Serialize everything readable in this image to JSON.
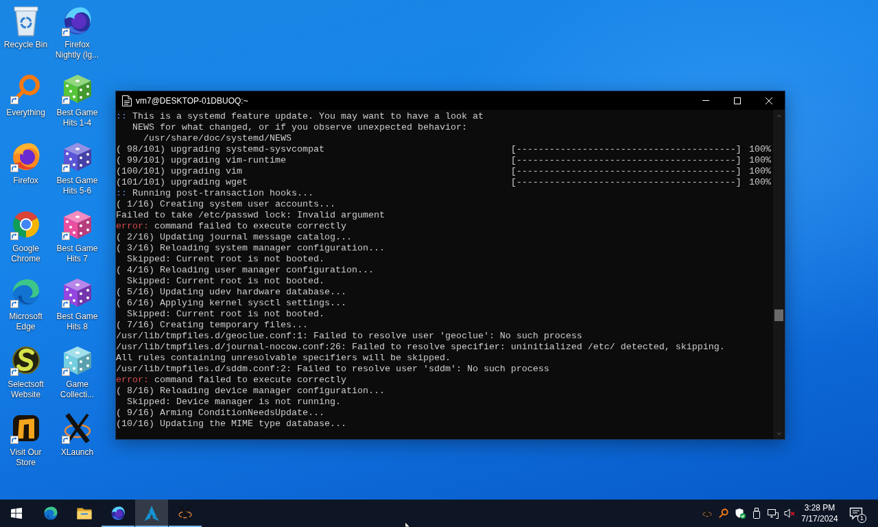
{
  "desktop": {
    "icons": [
      {
        "label": "Recycle Bin",
        "kind": "recycle",
        "shortcut": false
      },
      {
        "label": "Everything",
        "kind": "magnifier",
        "shortcut": true
      },
      {
        "label": "Firefox",
        "kind": "firefox",
        "shortcut": true
      },
      {
        "label": "Google Chrome",
        "kind": "chrome",
        "shortcut": true
      },
      {
        "label": "Microsoft Edge",
        "kind": "edge",
        "shortcut": true
      },
      {
        "label": "Selectsoft Website",
        "kind": "selectsoft",
        "shortcut": true
      },
      {
        "label": "Visit Our Store",
        "kind": "store",
        "shortcut": true
      },
      {
        "label": "Firefox Nightly (lg...",
        "kind": "nightly",
        "shortcut": true
      },
      {
        "label": "Best Game Hits 1-4",
        "kind": "dice",
        "color": "#58c43a",
        "shortcut": true
      },
      {
        "label": "Best Game Hits 5-6",
        "kind": "dice",
        "color": "#5b55d6",
        "shortcut": true
      },
      {
        "label": "Best Game Hits 7",
        "kind": "dice",
        "color": "#ec4fa0",
        "shortcut": true
      },
      {
        "label": "Best Game Hits 8",
        "kind": "dice",
        "color": "#9446de",
        "shortcut": true
      },
      {
        "label": "Game Collecti...",
        "kind": "dice",
        "color": "#74cfe0",
        "shortcut": true
      },
      {
        "label": "XLaunch",
        "kind": "xlaunch",
        "shortcut": true
      }
    ]
  },
  "terminal": {
    "title": "vm7@DESKTOP-01DBUOQ:~",
    "lines": [
      {
        "kind": "notice",
        "prefix": "::",
        "text": "This is a systemd feature update. You may want to have a look at"
      },
      {
        "kind": "plain",
        "text": "   NEWS for what changed, or if you observe unexpected behavior:"
      },
      {
        "kind": "plain",
        "text": "     /usr/share/doc/systemd/NEWS"
      },
      {
        "kind": "progress",
        "text": "( 98/101) upgrading systemd-sysvcompat",
        "bar": "[----------------------------------------]",
        "reading": "100%"
      },
      {
        "kind": "progress",
        "text": "( 99/101) upgrading vim-runtime",
        "bar": "[----------------------------------------]",
        "reading": "100%"
      },
      {
        "kind": "progress",
        "text": "(100/101) upgrading vim",
        "bar": "[----------------------------------------]",
        "reading": "100%"
      },
      {
        "kind": "progress",
        "text": "(101/101) upgrading wget",
        "bar": "[----------------------------------------]",
        "reading": "100%"
      },
      {
        "kind": "notice",
        "prefix": "::",
        "text": "Running post-transaction hooks..."
      },
      {
        "kind": "plain",
        "text": "( 1/16) Creating system user accounts..."
      },
      {
        "kind": "plain",
        "text": "Failed to take /etc/passwd lock: Invalid argument"
      },
      {
        "kind": "error",
        "prefix": "error:",
        "text": "command failed to execute correctly"
      },
      {
        "kind": "plain",
        "text": "( 2/16) Updating journal message catalog..."
      },
      {
        "kind": "plain",
        "text": "( 3/16) Reloading system manager configuration..."
      },
      {
        "kind": "plain",
        "text": "  Skipped: Current root is not booted."
      },
      {
        "kind": "plain",
        "text": "( 4/16) Reloading user manager configuration..."
      },
      {
        "kind": "plain",
        "text": "  Skipped: Current root is not booted."
      },
      {
        "kind": "plain",
        "text": "( 5/16) Updating udev hardware database..."
      },
      {
        "kind": "plain",
        "text": "( 6/16) Applying kernel sysctl settings..."
      },
      {
        "kind": "plain",
        "text": "  Skipped: Current root is not booted."
      },
      {
        "kind": "plain",
        "text": "( 7/16) Creating temporary files..."
      },
      {
        "kind": "plain",
        "text": "/usr/lib/tmpfiles.d/geoclue.conf:1: Failed to resolve user 'geoclue': No such process"
      },
      {
        "kind": "plain",
        "text": "/usr/lib/tmpfiles.d/journal-nocow.conf:26: Failed to resolve specifier: uninitialized /etc/ detected, skipping."
      },
      {
        "kind": "plain",
        "text": "All rules containing unresolvable specifiers will be skipped."
      },
      {
        "kind": "plain",
        "text": "/usr/lib/tmpfiles.d/sddm.conf:2: Failed to resolve user 'sddm': No such process"
      },
      {
        "kind": "error",
        "prefix": "error:",
        "text": "command failed to execute correctly"
      },
      {
        "kind": "plain",
        "text": "( 8/16) Reloading device manager configuration..."
      },
      {
        "kind": "plain",
        "text": "  Skipped: Device manager is not running."
      },
      {
        "kind": "plain",
        "text": "( 9/16) Arming ConditionNeedsUpdate..."
      },
      {
        "kind": "plain",
        "text": "(10/16) Updating the MIME type database..."
      }
    ]
  },
  "taskbar": {
    "apps": [
      {
        "kind": "edge",
        "running": false,
        "selected": false
      },
      {
        "kind": "explorer",
        "running": false,
        "selected": false
      },
      {
        "kind": "nightly",
        "running": true,
        "selected": false
      },
      {
        "kind": "arch",
        "running": true,
        "selected": true
      },
      {
        "kind": "xlaunch",
        "running": true,
        "selected": false
      }
    ],
    "volume": {
      "muted": true
    },
    "clock": {
      "time": "3:28 PM",
      "date": "7/17/2024"
    },
    "notifications": {
      "count": "1"
    }
  }
}
